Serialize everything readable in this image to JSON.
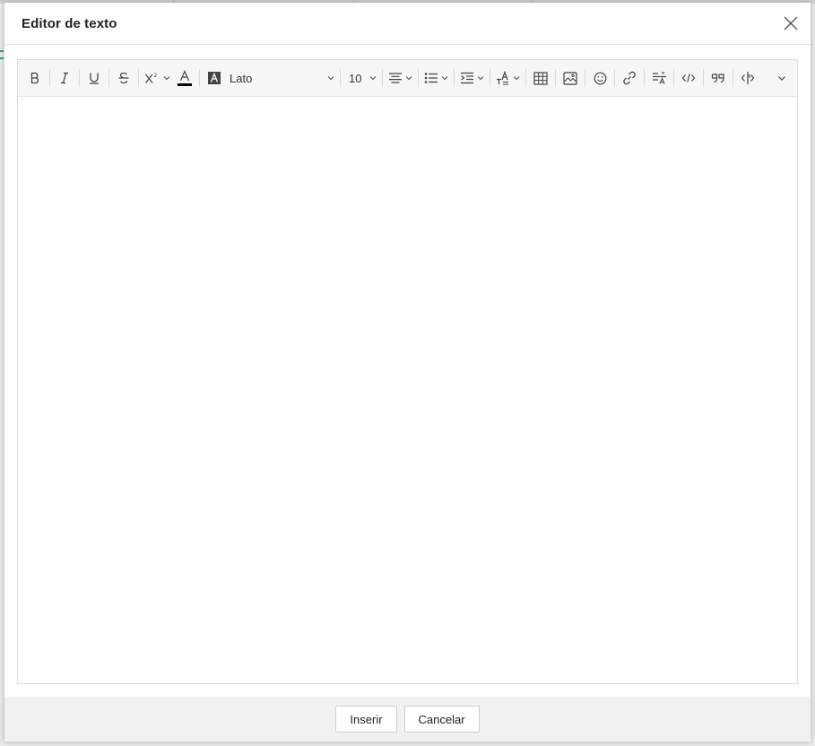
{
  "dialog": {
    "title": "Editor de texto"
  },
  "toolbar": {
    "font_family": "Lato",
    "font_size": "10",
    "font_color_swatch": "#000000"
  },
  "footer": {
    "insert_label": "Inserir",
    "cancel_label": "Cancelar"
  },
  "icons": [
    "bold-icon",
    "italic-icon",
    "underline-icon",
    "strikethrough-icon",
    "superscript-icon",
    "font-color-icon",
    "highlight-color-icon",
    "align-icon",
    "list-icon",
    "indent-icon",
    "text-style-icon",
    "table-icon",
    "image-icon",
    "emoji-icon",
    "link-icon",
    "paragraph-format-icon",
    "code-icon",
    "quote-icon",
    "source-icon",
    "more-chevron-icon"
  ]
}
